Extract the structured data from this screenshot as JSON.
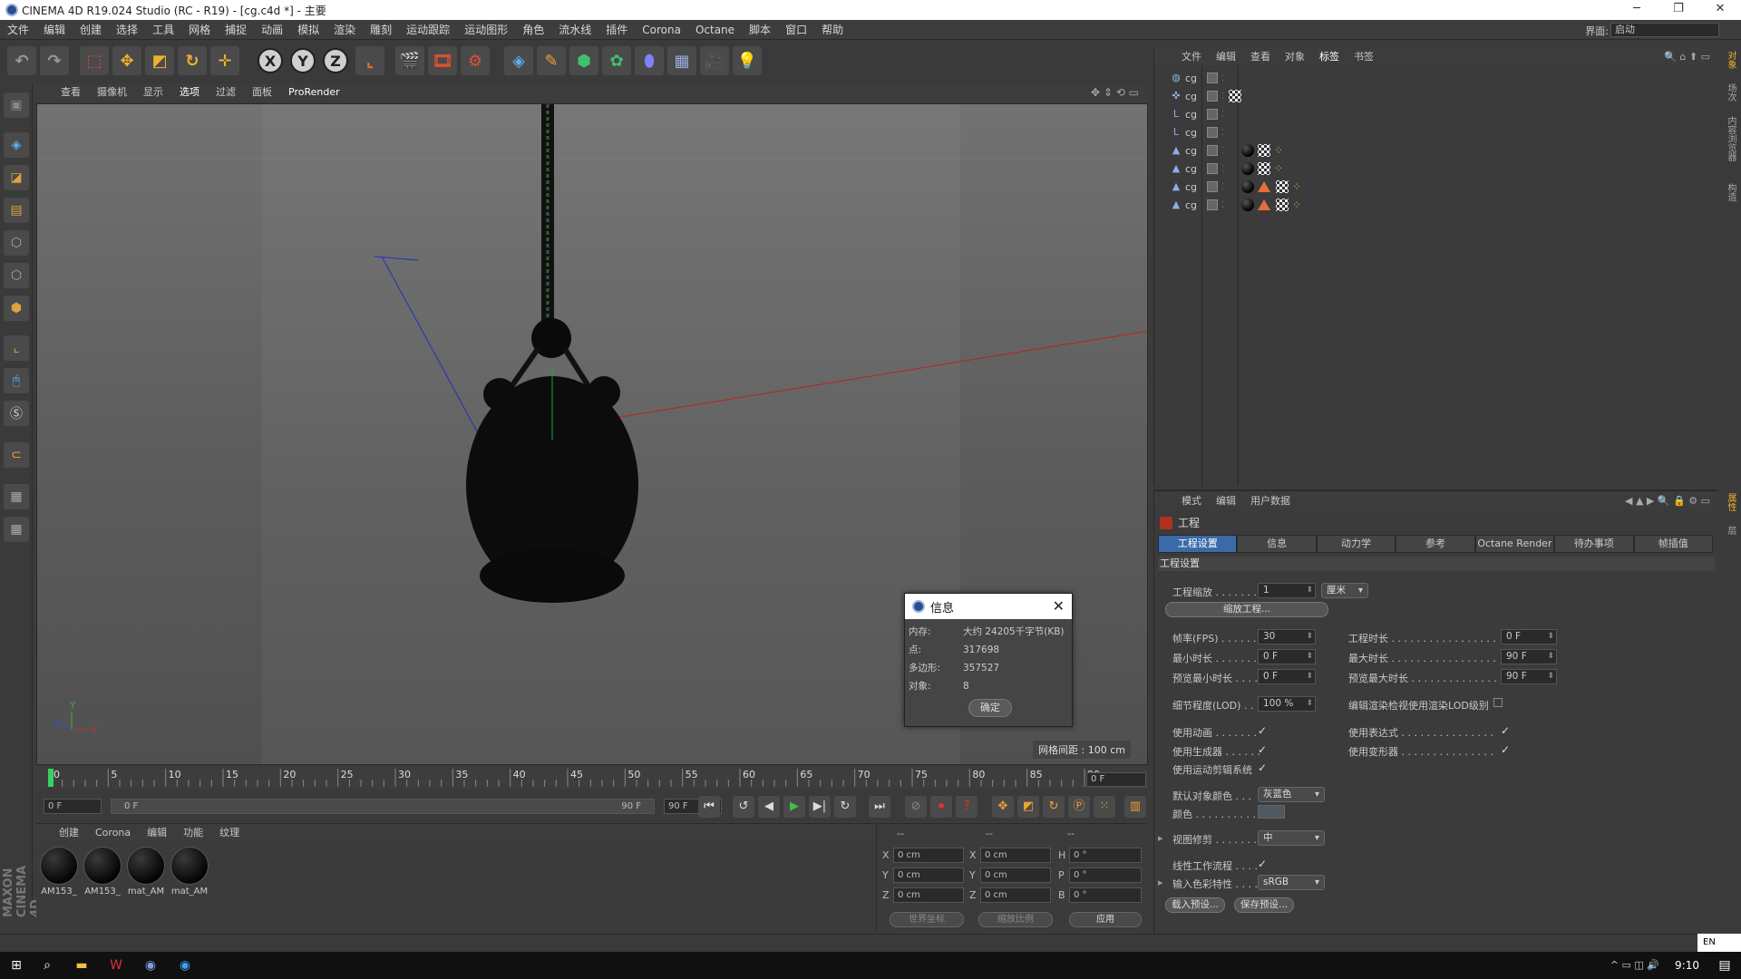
{
  "window": {
    "title": "CINEMA 4D R19.024 Studio (RC - R19) - [cg.c4d *] - 主要",
    "minimize": "─",
    "maximize": "❐",
    "close": "✕"
  },
  "menubar": {
    "items": [
      "文件",
      "编辑",
      "创建",
      "选择",
      "工具",
      "网格",
      "捕捉",
      "动画",
      "模拟",
      "渲染",
      "雕刻",
      "运动跟踪",
      "运动图形",
      "角色",
      "流水线",
      "插件",
      "Corona",
      "Octane",
      "脚本",
      "窗口",
      "帮助"
    ],
    "interface_label": "界面:",
    "interface_value": "启动"
  },
  "toolbar": {
    "x_axis": "X",
    "y_axis": "Y",
    "z_axis": "Z"
  },
  "viewport": {
    "menu": [
      "查看",
      "摄像机",
      "显示",
      "选项",
      "过滤",
      "面板",
      "ProRender"
    ],
    "active_menu": "选项",
    "grid_spacing": "网格间距 : 100 cm",
    "axis_x": "X",
    "axis_y": "Y",
    "axis_z": "Z"
  },
  "info_dialog": {
    "title": "信息",
    "close": "✕",
    "rows": [
      {
        "key": "内存:",
        "value": "大约 24205千字节(KB)"
      },
      {
        "key": "点:",
        "value": "317698"
      },
      {
        "key": "多边形:",
        "value": "357527"
      },
      {
        "key": "对象:",
        "value": "8"
      }
    ],
    "ok": "确定"
  },
  "timeline": {
    "ticks": [
      "0",
      "5",
      "10",
      "15",
      "20",
      "25",
      "30",
      "35",
      "40",
      "45",
      "50",
      "55",
      "60",
      "65",
      "70",
      "75",
      "80",
      "85",
      "90"
    ],
    "current_frame": "0 F",
    "frame_box": "0 F"
  },
  "transport": {
    "start_field": "0 F",
    "range_start": "0 F",
    "range_end": "90 F",
    "end_field": "90 F"
  },
  "materials": {
    "menu": [
      "创建",
      "Corona",
      "编辑",
      "功能",
      "纹理"
    ],
    "items": [
      "AM153_",
      "AM153_",
      "mat_AM",
      "mat_AM"
    ]
  },
  "coordinates": {
    "headers": [
      "--",
      "--",
      "--"
    ],
    "rows": [
      {
        "a": "X",
        "av": "0 cm",
        "b": "X",
        "bv": "0 cm",
        "c": "H",
        "cv": "0 °"
      },
      {
        "a": "Y",
        "av": "0 cm",
        "b": "Y",
        "bv": "0 cm",
        "c": "P",
        "cv": "0 °"
      },
      {
        "a": "Z",
        "av": "0 cm",
        "b": "Z",
        "bv": "0 cm",
        "c": "B",
        "cv": "0 °"
      }
    ],
    "world_coords": "世界坐标",
    "scale_ratio": "缩放比例",
    "apply": "应用"
  },
  "object_manager": {
    "menu": [
      "文件",
      "编辑",
      "查看",
      "对象",
      "标签",
      "书签"
    ],
    "active_menu": "标签",
    "objects": [
      {
        "name": "cg",
        "icon": "◍"
      },
      {
        "name": "cg",
        "icon": "✜"
      },
      {
        "name": "cg",
        "icon": "L"
      },
      {
        "name": "cg",
        "icon": "L"
      },
      {
        "name": "cg",
        "icon": "▲"
      },
      {
        "name": "cg",
        "icon": "▲"
      },
      {
        "name": "cg",
        "icon": "▲"
      },
      {
        "name": "cg",
        "icon": "▲"
      }
    ]
  },
  "right_tabs": [
    "对象",
    "场次",
    "内容浏览器",
    "构造",
    "属性",
    "层"
  ],
  "attributes": {
    "menu": [
      "模式",
      "编辑",
      "用户数据"
    ],
    "header": "工程",
    "tabs": [
      "工程设置",
      "信息",
      "动力学",
      "参考",
      "Octane Render",
      "待办事项",
      "帧插值"
    ],
    "active_tab": "工程设置",
    "section": "工程设置",
    "scale_label": "工程缩放 . . . . . . .",
    "scale_value": "1",
    "scale_unit": "厘米",
    "scale_project_btn": "缩放工程...",
    "fps_label": "帧率(FPS) . . . . . .",
    "fps_value": "30",
    "min_time_label": "最小时长 . . . . . . .",
    "min_time_value": "0 F",
    "preview_min_label": "预览最小时长 . . . .",
    "preview_min_value": "0 F",
    "project_time_label": "工程时长 . . . . . . . . . . . . . . . . . . . .",
    "project_time_value": "0 F",
    "max_time_label": "最大时长 . . . . . . . . . . . . . . . . . . . .",
    "max_time_value": "90 F",
    "preview_max_label": "预览最大时长 . . . . . . . . . . . . . . . . .",
    "preview_max_value": "90 F",
    "lod_label": "细节程度(LOD) . . .",
    "lod_value": "100 %",
    "render_lod_label": "编辑渲染检视使用渲染LOD级别",
    "use_anim_label": "使用动画 . . . . . . .",
    "use_expr_label": "使用表达式 . . . . . . . . . . . . . . . . . . .",
    "use_gen_label": "使用生成器 . . . . . .",
    "use_deform_label": "使用变形器 . . . . . . . . . . . . . . . . . . .",
    "use_motion_label": "使用运动剪辑系统",
    "default_color_label": "默认对象颜色 . . .",
    "default_color_value": "灰蓝色",
    "color_label": "颜色 . . . . . . . . . .",
    "view_clip_label": "视图修剪 . . . . . . .",
    "view_clip_value": "中",
    "linear_label": "线性工作流程 . . . .",
    "input_color_label": "输入色彩特性 . . . .",
    "input_color_value": "sRGB",
    "load_preset": "载入预设...",
    "save_preset": "保存预设...",
    "check": "✓"
  },
  "taskbar": {
    "time": "9:10",
    "ime": "EN"
  }
}
